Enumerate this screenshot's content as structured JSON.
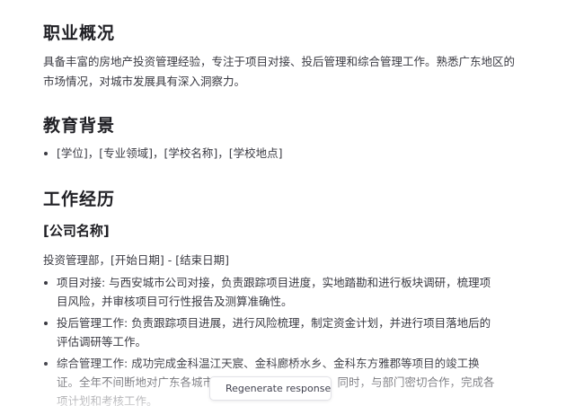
{
  "sections": {
    "profile": {
      "heading": "职业概况",
      "text": "具备丰富的房地产投资管理经验，专注于项目对接、投后管理和综合管理工作。熟悉广东地区的市场情况，对城市发展具有深入洞察力。"
    },
    "education": {
      "heading": "教育背景",
      "items": [
        "[学位]，[专业领域]，[学校名称]，[学校地点]"
      ]
    },
    "experience": {
      "heading": "工作经历",
      "company": "[公司名称]",
      "role_line": "投资管理部，[开始日期] - [结束日期]",
      "items": [
        "项目对接: 与西安城市公司对接，负责跟踪项目进度，实地踏勘和进行板块调研，梳理项目风险，并审核项目可行性报告及测算准确性。",
        "投后管理工作: 负责跟踪项目进展，进行风险梳理，制定资金计划，并进行项目落地后的评估调研等工作。",
        "综合管理工作: 成功完成金科温江天宸、金科廊桥水乡、金科东方雅郡等项目的竣工换证。全年不间断地对广东各城市土地市场进行跟踪调研，同时，与部门密切合作，完成各项计划和考核工作。"
      ]
    }
  },
  "controls": {
    "regenerate_label": "Regenerate response",
    "regenerate_icon": "refresh-icon"
  }
}
